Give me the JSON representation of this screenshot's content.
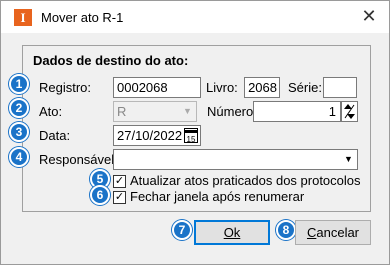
{
  "window": {
    "title": "Mover ato R-1",
    "app_icon_glyph": "I",
    "close_glyph": "✕",
    "accent_color": "#e8641e"
  },
  "group": {
    "title": "Dados de destino do ato:"
  },
  "badges": [
    "1",
    "2",
    "3",
    "4",
    "5",
    "6",
    "7",
    "8"
  ],
  "badge_color": "#1a73c8",
  "fields": {
    "registro_label": "Registro:",
    "registro_value": "0002068",
    "livro_label": "Livro:",
    "livro_value": "2068",
    "serie_label": "Série:",
    "serie_value": "",
    "ato_label": "Ato:",
    "ato_value": "R",
    "numero_label": "Número:",
    "numero_value": "1",
    "data_label": "Data:",
    "data_value": "27/10/2022",
    "responsavel_label": "Responsável:",
    "responsavel_value": ""
  },
  "options": {
    "atualizar_label": "Atualizar atos praticados dos protocolos",
    "atualizar_checked": true,
    "fechar_label": "Fechar janela após renumerar",
    "fechar_checked": true
  },
  "buttons": {
    "ok_label": "Ok",
    "cancelar_label": "Cancelar"
  },
  "icons": {
    "calendar": "calendar-icon",
    "spinner": "spinner-icon",
    "dropdown": "chevron-down-icon"
  }
}
